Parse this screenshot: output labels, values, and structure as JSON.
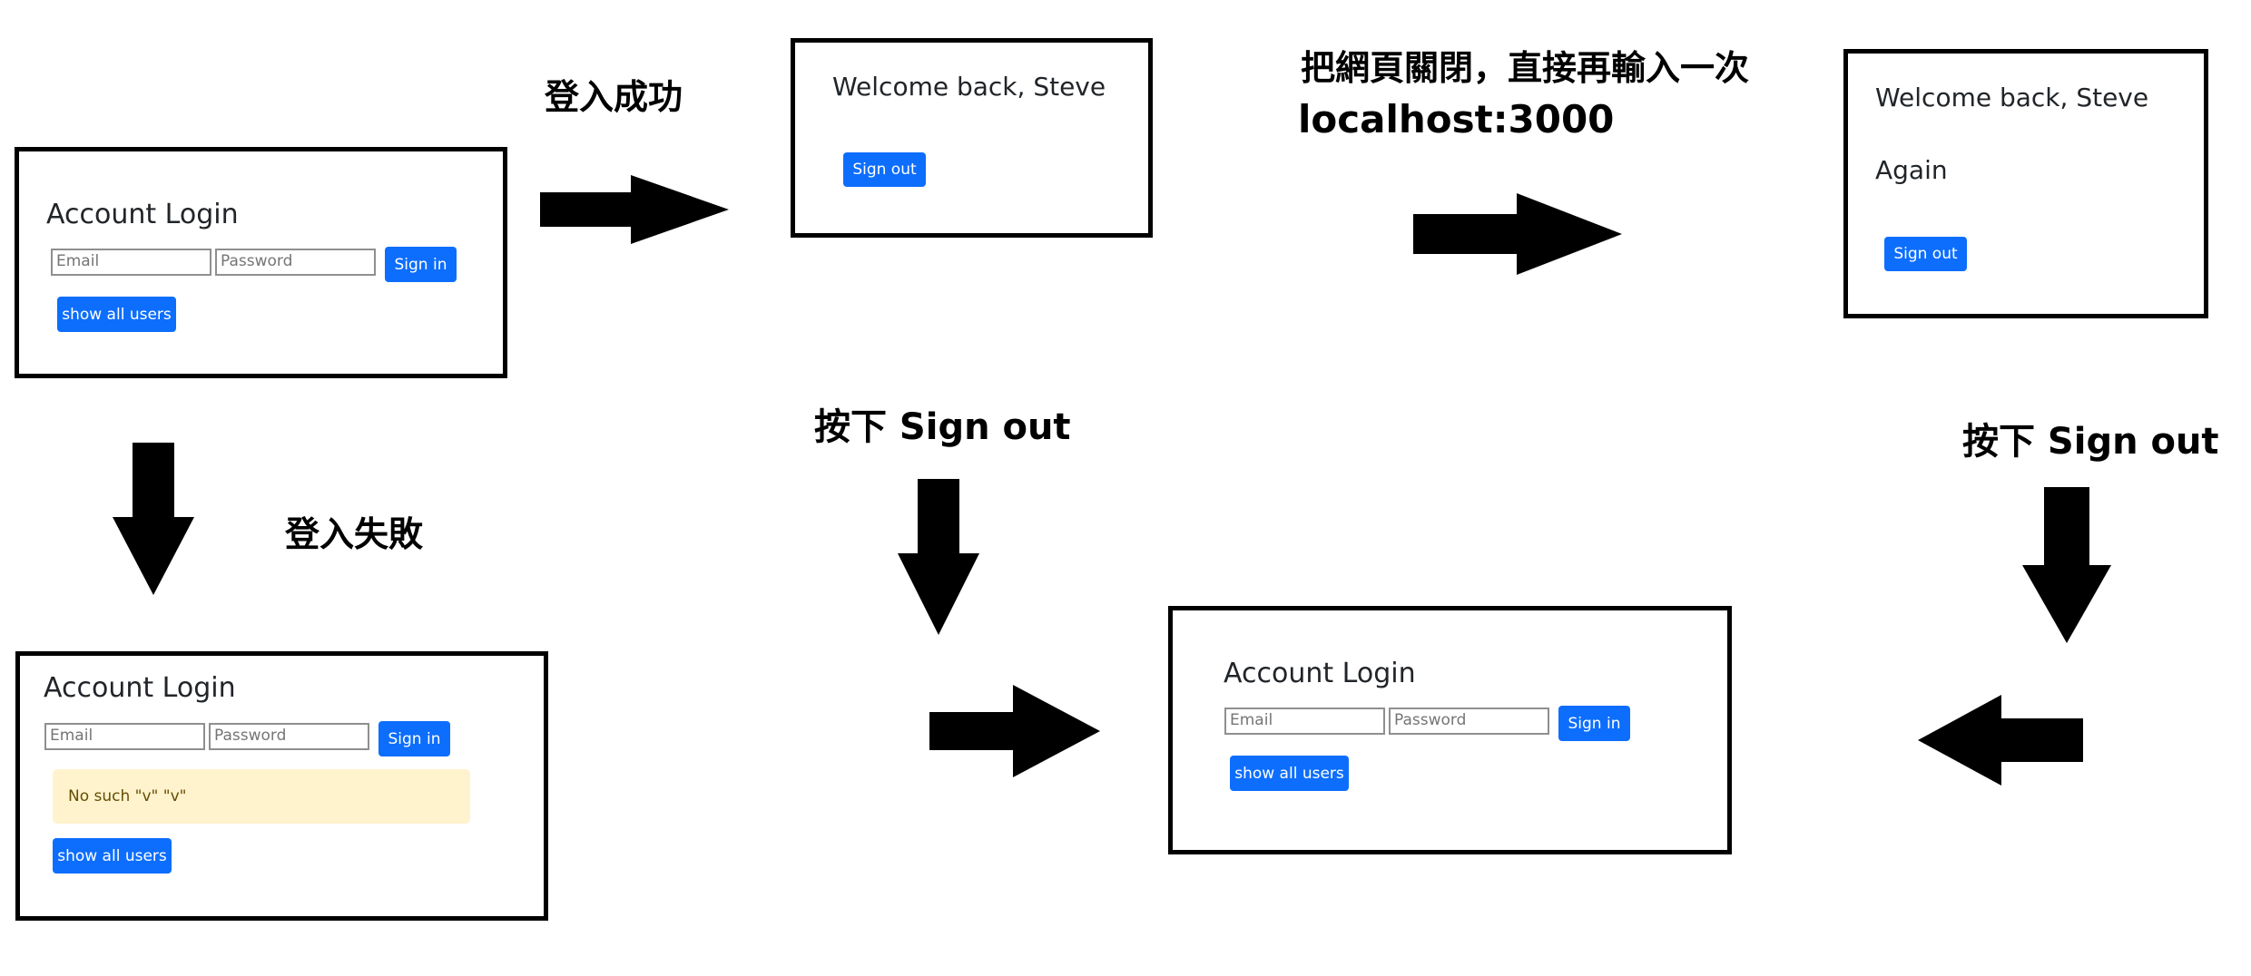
{
  "captions": {
    "login_success": "登入成功",
    "login_fail": "登入失敗",
    "close_and_reenter_line1": "把網頁關閉，直接再輸入一次",
    "close_and_reenter_line2": "localhost:3000",
    "press_sign_out_left": "按下 Sign out",
    "press_sign_out_right": "按下 Sign out"
  },
  "login_panel": {
    "title": "Account Login",
    "email_placeholder": "Email",
    "password_placeholder": "Password",
    "sign_in": "Sign in",
    "show_all_users": "show all users"
  },
  "welcome_panel": {
    "greeting": "Welcome back, Steve",
    "sign_out": "Sign out"
  },
  "welcome_again_panel": {
    "greeting": "Welcome back, Steve",
    "again": "Again",
    "sign_out": "Sign out"
  },
  "failed_login_panel": {
    "title": "Account Login",
    "email_placeholder": "Email",
    "password_placeholder": "Password",
    "sign_in": "Sign in",
    "error_message": "No such \"v\" \"v\"",
    "show_all_users": "show all users"
  },
  "result_login_panel": {
    "title": "Account Login",
    "email_placeholder": "Email",
    "password_placeholder": "Password",
    "sign_in": "Sign in",
    "show_all_users": "show all users"
  },
  "colors": {
    "primary_button": "#0d6efd",
    "alert_background": "#fff3cd",
    "arrow": "#000000"
  }
}
